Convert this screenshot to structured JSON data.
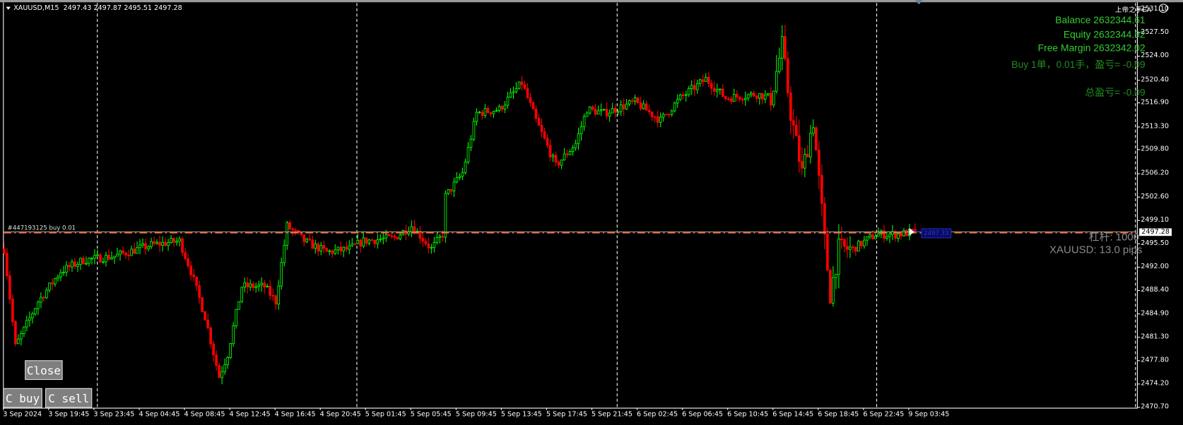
{
  "header": {
    "symbol": "XAUUSD,M15",
    "ohlc": "2497.43 2497.87 2495.51 2497.28"
  },
  "ea_panel": {
    "ea_name": "上帝之手EA",
    "balance": "Balance 2632344.61",
    "equity": "Equity 2632344.52",
    "free_margin": "Free Margin 2632342.02",
    "position": "Buy 1单，0.01手，盈亏= -0.09",
    "total_pl": "总盈亏= -0.09",
    "leverage": "杠杆: 1000",
    "spread": "XAUUSD: 13.0 pips"
  },
  "buttons": {
    "close": "Close",
    "close_buy": "C buy",
    "close_sell": "C sell"
  },
  "order_line": {
    "label": "#447193125 buy 0.01",
    "price": 2497.28,
    "marker_label": "2497.33"
  },
  "colors": {
    "bull": "#00ff00",
    "bear": "#ff0000",
    "balance": "#32cd32",
    "position": "#228b22",
    "order_line": "#e0703a"
  },
  "price_axis": {
    "current": "2497.28",
    "labels": [
      "2531.10",
      "2527.50",
      "2524.00",
      "2520.40",
      "2516.90",
      "2513.30",
      "2509.80",
      "2506.20",
      "2502.60",
      "2499.10",
      "2495.50",
      "2492.00",
      "2488.40",
      "2484.90",
      "2481.30",
      "2477.80",
      "2474.20",
      "2470.70"
    ]
  },
  "time_axis": {
    "labels": [
      "3 Sep 2024",
      "3 Sep 19:45",
      "3 Sep 23:45",
      "4 Sep 04:45",
      "4 Sep 08:45",
      "4 Sep 12:45",
      "4 Sep 16:45",
      "4 Sep 20:45",
      "5 Sep 01:45",
      "5 Sep 05:45",
      "5 Sep 09:45",
      "5 Sep 13:45",
      "5 Sep 17:45",
      "5 Sep 21:45",
      "6 Sep 02:45",
      "6 Sep 06:45",
      "6 Sep 10:45",
      "6 Sep 14:45",
      "6 Sep 18:45",
      "6 Sep 22:45",
      "9 Sep 03:45"
    ]
  },
  "chart_data": {
    "type": "candlestick",
    "ylim": [
      2470.7,
      2531.1
    ],
    "bars_per_time_label": 16,
    "price_path": [
      [
        0,
        2494.7
      ],
      [
        4,
        2479.9
      ],
      [
        12,
        2486.7
      ],
      [
        20,
        2491.3
      ],
      [
        28,
        2493
      ],
      [
        39,
        2493.6
      ],
      [
        52,
        2495.3
      ],
      [
        62,
        2495.9
      ],
      [
        66,
        2491.3
      ],
      [
        71,
        2484.4
      ],
      [
        76,
        2475.3
      ],
      [
        79,
        2478.7
      ],
      [
        84,
        2489
      ],
      [
        92,
        2489
      ],
      [
        96,
        2486.7
      ],
      [
        100,
        2498.2
      ],
      [
        106,
        2495.9
      ],
      [
        114,
        2494.2
      ],
      [
        122,
        2494.7
      ],
      [
        127,
        2495.9
      ],
      [
        138,
        2496.4
      ],
      [
        144,
        2498.2
      ],
      [
        151,
        2494.7
      ],
      [
        155,
        2496.9
      ],
      [
        156,
        2502.7
      ],
      [
        162,
        2506.2
      ],
      [
        167,
        2515.3
      ],
      [
        175,
        2515.9
      ],
      [
        183,
        2519.9
      ],
      [
        188,
        2514.2
      ],
      [
        195,
        2507.3
      ],
      [
        202,
        2510.7
      ],
      [
        206,
        2515.9
      ],
      [
        212,
        2515.3
      ],
      [
        223,
        2517
      ],
      [
        232,
        2514.2
      ],
      [
        239,
        2517.6
      ],
      [
        248,
        2520.5
      ],
      [
        255,
        2517.6
      ],
      [
        266,
        2518.2
      ],
      [
        271,
        2517.6
      ],
      [
        275,
        2525.6
      ],
      [
        278,
        2515.3
      ],
      [
        282,
        2506.2
      ],
      [
        286,
        2514.2
      ],
      [
        288,
        2505
      ],
      [
        290,
        2495.9
      ],
      [
        292,
        2487.8
      ],
      [
        295,
        2494.7
      ],
      [
        300,
        2494.7
      ],
      [
        308,
        2496.9
      ],
      [
        315,
        2496.9
      ],
      [
        322,
        2497.28
      ]
    ]
  }
}
